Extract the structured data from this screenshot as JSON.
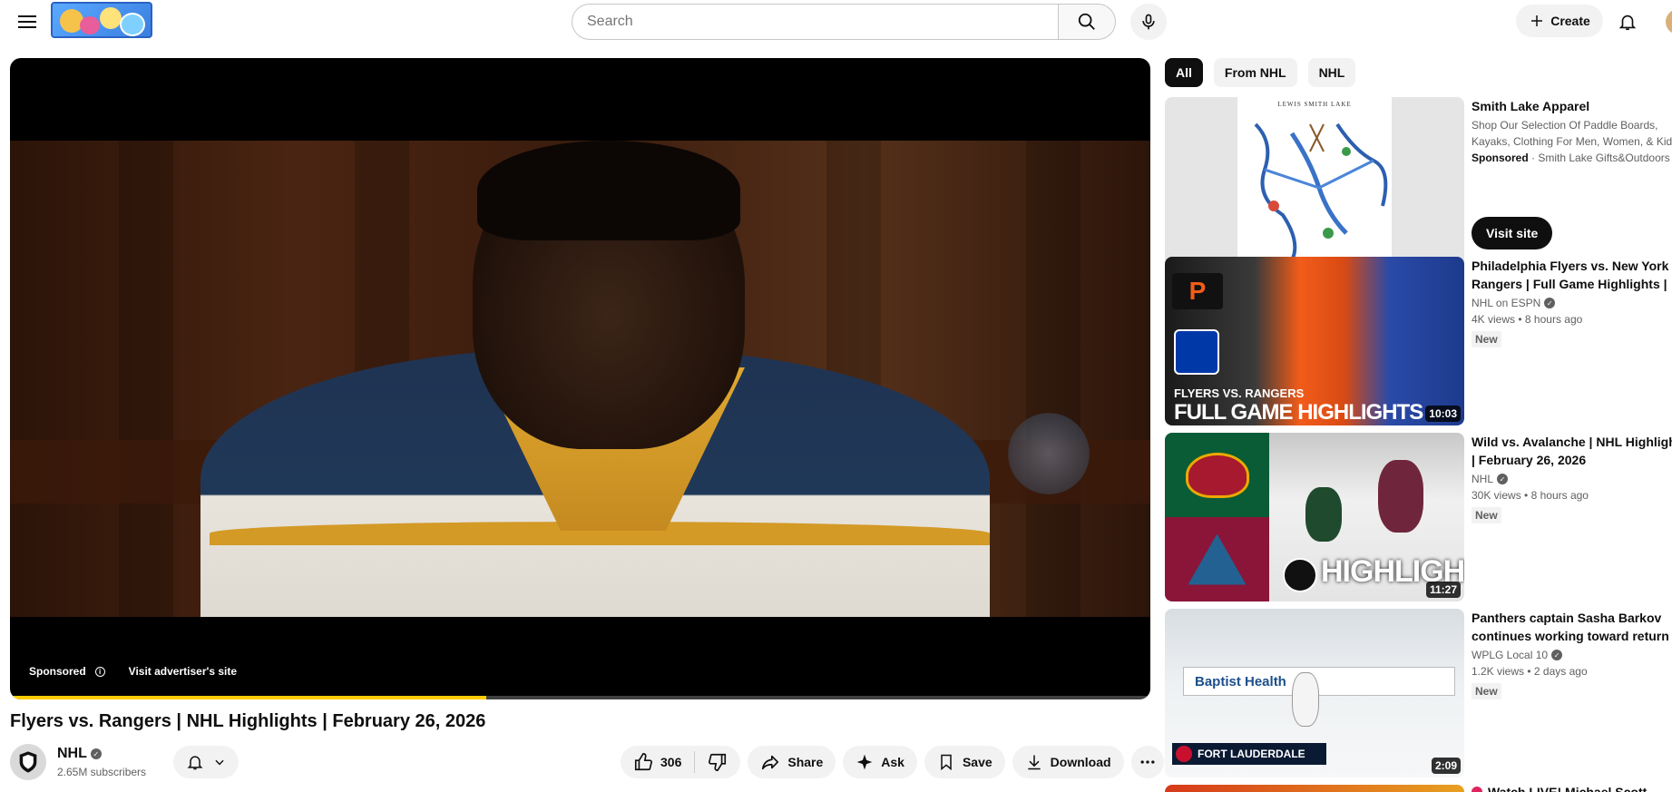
{
  "header": {
    "search_placeholder": "Search",
    "create_label": "Create"
  },
  "player": {
    "ad_sponsored_label": "Sponsored",
    "ad_visit_label": "Visit advertiser's site",
    "progress_fraction": 0.418,
    "progress_color": "#ffcc00"
  },
  "video": {
    "title": "Flyers vs. Rangers | NHL Highlights | February 26, 2026",
    "channel_name": "NHL",
    "subscribers": "2.65M subscribers",
    "likes": "306"
  },
  "actions": {
    "share": "Share",
    "ask": "Ask",
    "save": "Save",
    "download": "Download"
  },
  "chips": [
    {
      "label": "All",
      "active": true
    },
    {
      "label": "From NHL",
      "active": false
    },
    {
      "label": "NHL",
      "active": false
    }
  ],
  "sidebar_ad": {
    "title": "Smith Lake Apparel",
    "description": "Shop Our Selection Of Paddle Boards, Kayaks, Clothing For Men, Women, & Kids",
    "sponsored_label": "Sponsored",
    "advertiser": "Smith Lake Gifts&Outdoors",
    "visit_label": "Visit site",
    "map_title": "LEWIS SMITH LAKE"
  },
  "recommendations": [
    {
      "title": "Philadelphia Flyers vs. New York Rangers | Full Game Highlights | NHL on ESPN",
      "channel": "NHL on ESPN",
      "views": "4K views",
      "age": "8 hours ago",
      "badge": "New",
      "duration": "10:03",
      "thumb_caption_small": "FLYERS VS. RANGERS",
      "thumb_caption_big": "FULL GAME HIGHLIGHTS"
    },
    {
      "title": "Wild vs. Avalanche | NHL Highlights | February 26, 2026",
      "channel": "NHL",
      "views": "30K views",
      "age": "8 hours ago",
      "badge": "New",
      "duration": "11:27",
      "thumb_caption_big": "HIGHLIGHTS"
    },
    {
      "title": "Panthers captain Sasha Barkov continues working toward return",
      "channel": "WPLG Local 10",
      "views": "1.2K views",
      "age": "2 days ago",
      "badge": "New",
      "duration": "2:09",
      "thumb_caption_big": "FORT LAUDERDALE",
      "thumb_board_text": "Baptist Health"
    },
    {
      "title": "Watch LIVE! Michael Scott"
    }
  ]
}
